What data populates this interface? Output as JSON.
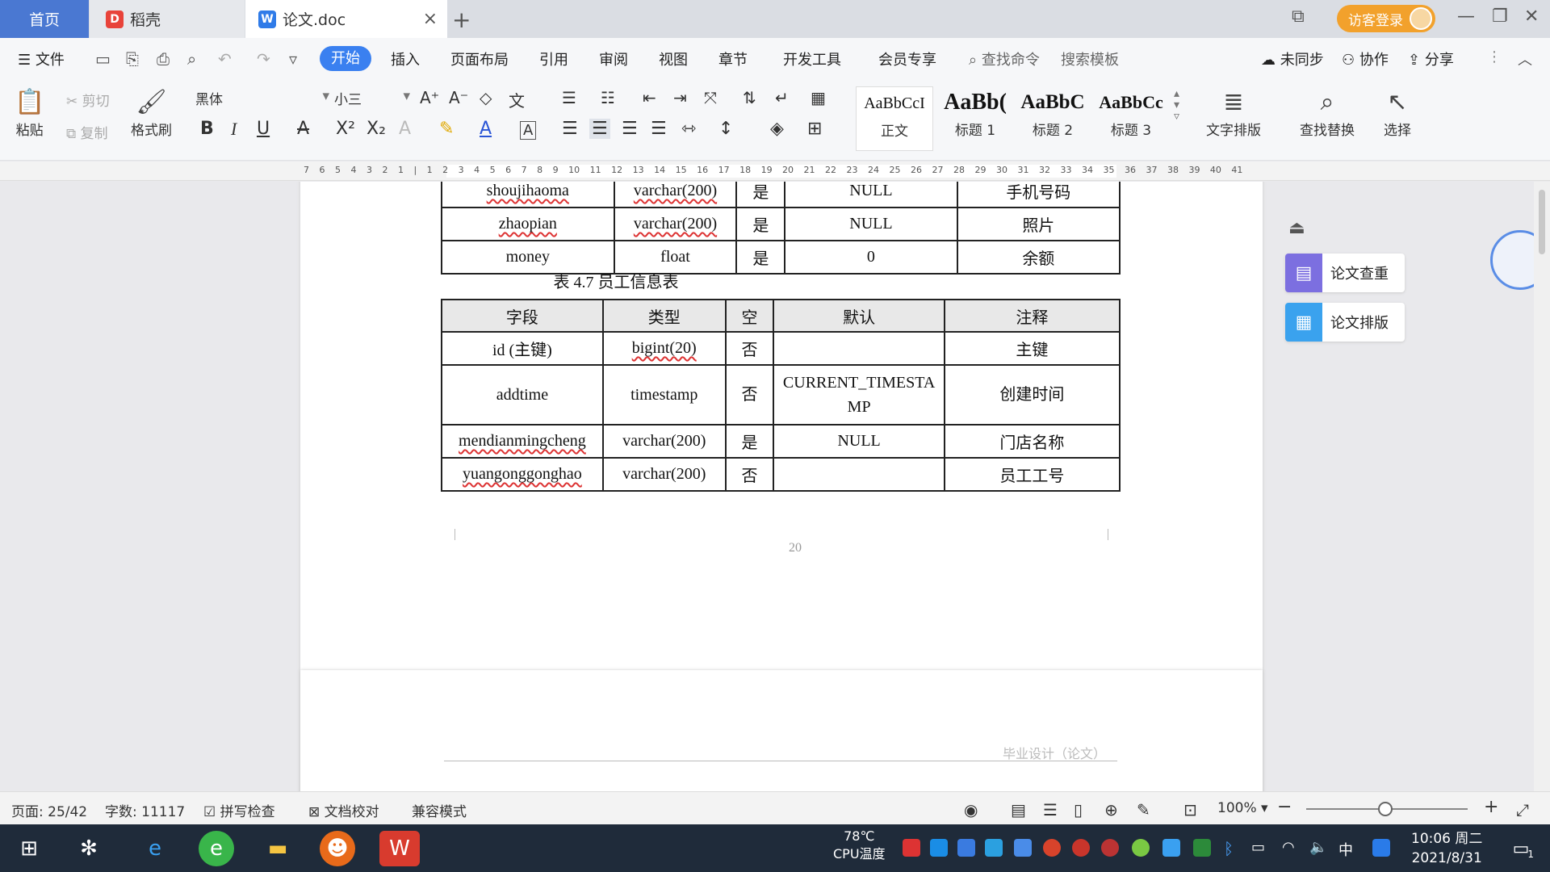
{
  "tabs": {
    "home": "首页",
    "daoke": "稻壳",
    "doc": "论文.doc"
  },
  "titlebar": {
    "login": "访客登录"
  },
  "menu": {
    "file": "文件",
    "items": [
      "开始",
      "插入",
      "页面布局",
      "引用",
      "审阅",
      "视图",
      "章节",
      "开发工具",
      "会员专享"
    ],
    "search_cmd": "查找命令",
    "search_tpl": "搜索模板",
    "unsync": "未同步",
    "collab": "协作",
    "share": "分享"
  },
  "ribbon": {
    "paste": "粘贴",
    "cut": "剪切",
    "copy": "复制",
    "format_painter": "格式刷",
    "font_name": "黑体",
    "font_size": "小三",
    "styles": [
      {
        "preview": "AaBbCcI",
        "label": "正文"
      },
      {
        "preview": "AaBb(",
        "label": "标题 1"
      },
      {
        "preview": "AaBbC",
        "label": "标题 2"
      },
      {
        "preview": "AaBbCc",
        "label": "标题 3"
      }
    ],
    "text_layout": "文字排版",
    "find_replace": "查找替换",
    "select": "选择"
  },
  "ruler": {
    "numbers": "7 6 5 4 3 2 1 | 1 2 3 4 5 6 7 8 9 10 11 12 13 14 15 16 17 18 19 20 21 22 23 24 25 26 27 28 29 30 31 32 33 34 35 36 37 38 39 40 41"
  },
  "document": {
    "table_prev": [
      [
        "shoujihaoma",
        "varchar(200)",
        "是",
        "NULL",
        "手机号码"
      ],
      [
        "zhaopian",
        "varchar(200)",
        "是",
        "NULL",
        "照片"
      ],
      [
        "money",
        "float",
        "是",
        "0",
        "余额"
      ]
    ],
    "caption": "表 4.7  员工信息表",
    "table_header": [
      "字段",
      "类型",
      "空",
      "默认",
      "注释"
    ],
    "table_rows": [
      [
        "id (主键)",
        "bigint(20)",
        "否",
        "",
        "主键"
      ],
      [
        "addtime",
        "timestamp",
        "否",
        "CURRENT_TIMESTAMP",
        "创建时间"
      ],
      [
        "mendianmingcheng",
        "varchar(200)",
        "是",
        "NULL",
        "门店名称"
      ],
      [
        "yuangonggonghao",
        "varchar(200)",
        "否",
        "",
        "员工工号"
      ]
    ],
    "page_number": "20",
    "next_page_header": "毕业设计（论文）"
  },
  "side_panel": {
    "check": "论文查重",
    "layout": "论文排版"
  },
  "status": {
    "page": "页面: 25/42",
    "words": "字数: 11117",
    "spell": "拼写检查",
    "proof": "文档校对",
    "compat": "兼容模式",
    "zoom": "100%"
  },
  "taskbar": {
    "cpu_temp": "78℃",
    "cpu_label": "CPU温度",
    "ime": "中",
    "time": "10:06 周二",
    "date": "2021/8/31",
    "notify_count": "1"
  },
  "colors": {
    "accent": "#3a80f0",
    "home_tab": "#4a78d2",
    "login": "#f2a12c",
    "check_btn": "#7c6fe0",
    "layout_btn": "#3aa2ee"
  }
}
